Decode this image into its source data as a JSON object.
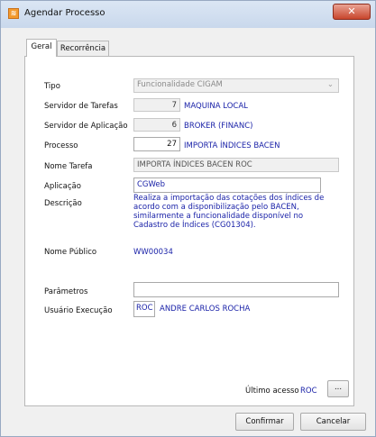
{
  "window": {
    "title": "Agendar Processo",
    "close_glyph": "✕"
  },
  "tabs": [
    {
      "label": "Geral"
    },
    {
      "label": "Recorrência"
    }
  ],
  "form": {
    "tipo": {
      "label": "Tipo",
      "value": "Funcionalidade CIGAM"
    },
    "servidor_tarefas": {
      "label": "Servidor de Tarefas",
      "code": "7",
      "name": "MAQUINA LOCAL"
    },
    "servidor_aplicacao": {
      "label": "Servidor de Aplicação",
      "code": "6",
      "name": "BROKER (FINANC)"
    },
    "processo": {
      "label": "Processo",
      "code": "27",
      "name": "IMPORTA ÍNDICES BACEN"
    },
    "nome_tarefa": {
      "label": "Nome Tarefa",
      "value": "IMPORTA ÍNDICES BACEN ROC"
    },
    "aplicacao": {
      "label": "Aplicação",
      "value": "CGWeb"
    },
    "descricao": {
      "label": "Descrição",
      "value": "Realiza a importação das cotações dos índices de acordo com a disponibilização pelo BACEN, similarmente a funcionalidade disponível no Cadastro de Índices (CG01304)."
    },
    "nome_publico": {
      "label": "Nome Público",
      "value": "WW00034"
    },
    "parametros": {
      "label": "Parâmetros",
      "value": ""
    },
    "usuario_execucao": {
      "label": "Usuário Execução",
      "code": "ROC",
      "name": "ANDRE CARLOS ROCHA"
    },
    "ultimo_acesso": {
      "label": "Último acesso",
      "value": "ROC",
      "button": "..."
    }
  },
  "buttons": {
    "confirmar": "Confirmar",
    "cancelar": "Cancelar"
  },
  "colors": {
    "accent_text": "#1a22a8",
    "titlebar": "#c9d8ec",
    "close": "#c8452c"
  }
}
